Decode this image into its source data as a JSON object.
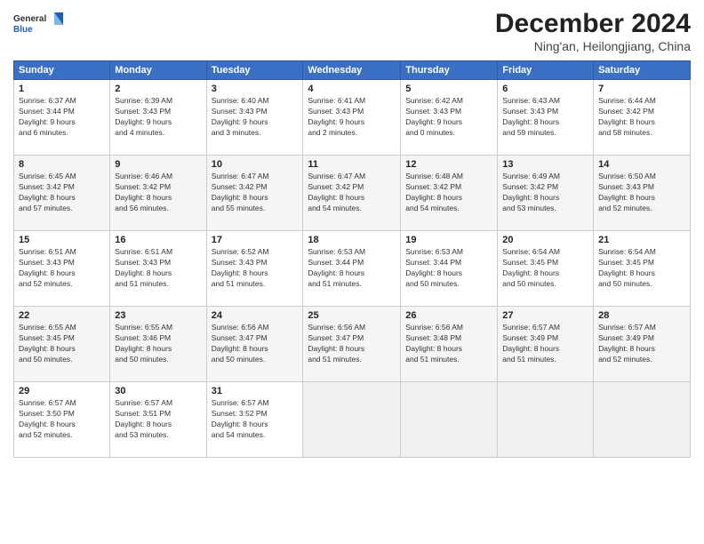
{
  "logo": {
    "line1": "General",
    "line2": "Blue"
  },
  "title": "December 2024",
  "location": "Ning'an, Heilongjiang, China",
  "days_of_week": [
    "Sunday",
    "Monday",
    "Tuesday",
    "Wednesday",
    "Thursday",
    "Friday",
    "Saturday"
  ],
  "weeks": [
    [
      {
        "day": "1",
        "info": "Sunrise: 6:37 AM\nSunset: 3:44 PM\nDaylight: 9 hours\nand 6 minutes."
      },
      {
        "day": "2",
        "info": "Sunrise: 6:39 AM\nSunset: 3:43 PM\nDaylight: 9 hours\nand 4 minutes."
      },
      {
        "day": "3",
        "info": "Sunrise: 6:40 AM\nSunset: 3:43 PM\nDaylight: 9 hours\nand 3 minutes."
      },
      {
        "day": "4",
        "info": "Sunrise: 6:41 AM\nSunset: 3:43 PM\nDaylight: 9 hours\nand 2 minutes."
      },
      {
        "day": "5",
        "info": "Sunrise: 6:42 AM\nSunset: 3:43 PM\nDaylight: 9 hours\nand 0 minutes."
      },
      {
        "day": "6",
        "info": "Sunrise: 6:43 AM\nSunset: 3:43 PM\nDaylight: 8 hours\nand 59 minutes."
      },
      {
        "day": "7",
        "info": "Sunrise: 6:44 AM\nSunset: 3:42 PM\nDaylight: 8 hours\nand 58 minutes."
      }
    ],
    [
      {
        "day": "8",
        "info": "Sunrise: 6:45 AM\nSunset: 3:42 PM\nDaylight: 8 hours\nand 57 minutes."
      },
      {
        "day": "9",
        "info": "Sunrise: 6:46 AM\nSunset: 3:42 PM\nDaylight: 8 hours\nand 56 minutes."
      },
      {
        "day": "10",
        "info": "Sunrise: 6:47 AM\nSunset: 3:42 PM\nDaylight: 8 hours\nand 55 minutes."
      },
      {
        "day": "11",
        "info": "Sunrise: 6:47 AM\nSunset: 3:42 PM\nDaylight: 8 hours\nand 54 minutes."
      },
      {
        "day": "12",
        "info": "Sunrise: 6:48 AM\nSunset: 3:42 PM\nDaylight: 8 hours\nand 54 minutes."
      },
      {
        "day": "13",
        "info": "Sunrise: 6:49 AM\nSunset: 3:42 PM\nDaylight: 8 hours\nand 53 minutes."
      },
      {
        "day": "14",
        "info": "Sunrise: 6:50 AM\nSunset: 3:43 PM\nDaylight: 8 hours\nand 52 minutes."
      }
    ],
    [
      {
        "day": "15",
        "info": "Sunrise: 6:51 AM\nSunset: 3:43 PM\nDaylight: 8 hours\nand 52 minutes."
      },
      {
        "day": "16",
        "info": "Sunrise: 6:51 AM\nSunset: 3:43 PM\nDaylight: 8 hours\nand 51 minutes."
      },
      {
        "day": "17",
        "info": "Sunrise: 6:52 AM\nSunset: 3:43 PM\nDaylight: 8 hours\nand 51 minutes."
      },
      {
        "day": "18",
        "info": "Sunrise: 6:53 AM\nSunset: 3:44 PM\nDaylight: 8 hours\nand 51 minutes."
      },
      {
        "day": "19",
        "info": "Sunrise: 6:53 AM\nSunset: 3:44 PM\nDaylight: 8 hours\nand 50 minutes."
      },
      {
        "day": "20",
        "info": "Sunrise: 6:54 AM\nSunset: 3:45 PM\nDaylight: 8 hours\nand 50 minutes."
      },
      {
        "day": "21",
        "info": "Sunrise: 6:54 AM\nSunset: 3:45 PM\nDaylight: 8 hours\nand 50 minutes."
      }
    ],
    [
      {
        "day": "22",
        "info": "Sunrise: 6:55 AM\nSunset: 3:45 PM\nDaylight: 8 hours\nand 50 minutes."
      },
      {
        "day": "23",
        "info": "Sunrise: 6:55 AM\nSunset: 3:46 PM\nDaylight: 8 hours\nand 50 minutes."
      },
      {
        "day": "24",
        "info": "Sunrise: 6:56 AM\nSunset: 3:47 PM\nDaylight: 8 hours\nand 50 minutes."
      },
      {
        "day": "25",
        "info": "Sunrise: 6:56 AM\nSunset: 3:47 PM\nDaylight: 8 hours\nand 51 minutes."
      },
      {
        "day": "26",
        "info": "Sunrise: 6:56 AM\nSunset: 3:48 PM\nDaylight: 8 hours\nand 51 minutes."
      },
      {
        "day": "27",
        "info": "Sunrise: 6:57 AM\nSunset: 3:49 PM\nDaylight: 8 hours\nand 51 minutes."
      },
      {
        "day": "28",
        "info": "Sunrise: 6:57 AM\nSunset: 3:49 PM\nDaylight: 8 hours\nand 52 minutes."
      }
    ],
    [
      {
        "day": "29",
        "info": "Sunrise: 6:57 AM\nSunset: 3:50 PM\nDaylight: 8 hours\nand 52 minutes."
      },
      {
        "day": "30",
        "info": "Sunrise: 6:57 AM\nSunset: 3:51 PM\nDaylight: 8 hours\nand 53 minutes."
      },
      {
        "day": "31",
        "info": "Sunrise: 6:57 AM\nSunset: 3:52 PM\nDaylight: 8 hours\nand 54 minutes."
      },
      {
        "day": "",
        "info": ""
      },
      {
        "day": "",
        "info": ""
      },
      {
        "day": "",
        "info": ""
      },
      {
        "day": "",
        "info": ""
      }
    ]
  ]
}
